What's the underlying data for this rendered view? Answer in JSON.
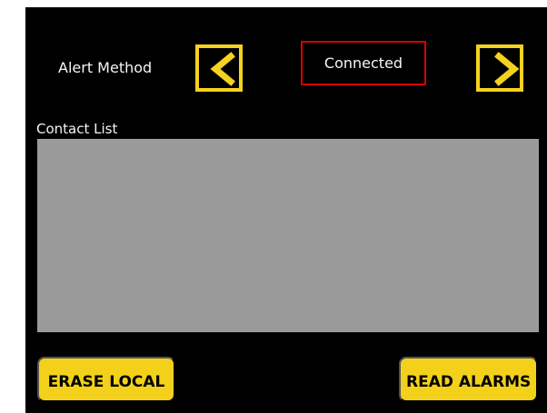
{
  "labels": {
    "alert_method": "Alert Method",
    "contact_list": "Contact List"
  },
  "status": {
    "value": "Connected"
  },
  "buttons": {
    "previous_icon": "chevron-left-icon",
    "next_icon": "chevron-right-icon",
    "erase_local": "ERASE LOCAL",
    "read_alarms": "READ ALARMS"
  },
  "contact_list": {
    "entries": []
  },
  "colors": {
    "background": "#000000",
    "accent": "#f5d21f",
    "status_border": "#d90000",
    "list_background": "#9a9a9a",
    "text": "#f5f5f5"
  }
}
